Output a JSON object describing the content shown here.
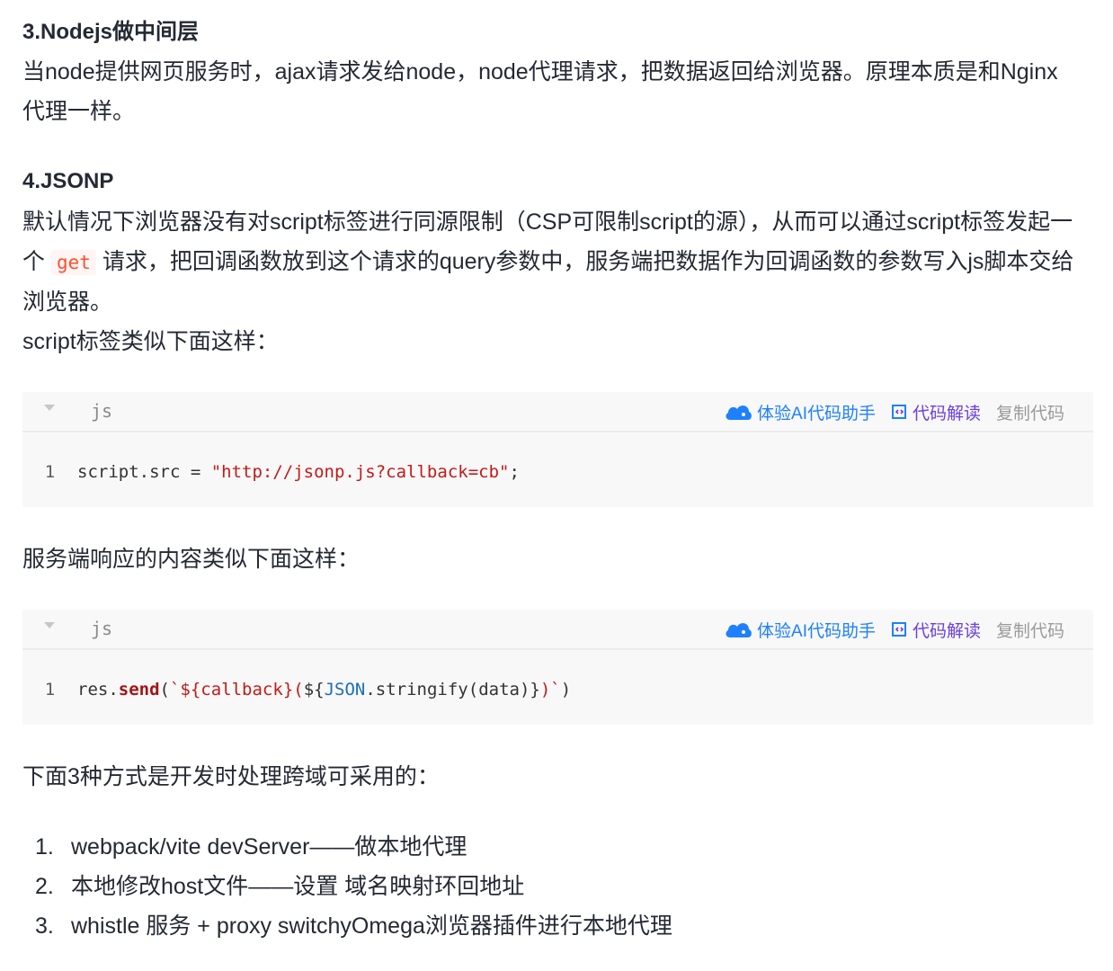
{
  "sections": {
    "nodejs": {
      "title": "3.Nodejs做中间层",
      "body_line1": "当node提供网页服务时，ajax请求发给node，node代理请求，把数据返回给浏览器。原理本质是和Nginx",
      "body_line2": "代理一样。"
    },
    "jsonp": {
      "title": "4.JSONP",
      "line1": "默认情况下浏览器没有对script标签进行同源限制（CSP可限制script的源），从而可以通过script标签发起一",
      "line2_pre": "个 ",
      "line2_code": "get",
      "line2_post": " 请求，把回调函数放到这个请求的query参数中，服务端把数据作为回调函数的参数写入js脚本交给",
      "line3": "浏览器。",
      "script_intro": "script标签类似下面这样："
    },
    "server_intro": "服务端响应的内容类似下面这样：",
    "methods_intro": "下面3种方式是开发时处理跨域可采用的："
  },
  "code_toolbar": {
    "ai_label": "体验AI代码助手",
    "read_label": "代码解读",
    "copy_label": "复制代码"
  },
  "code_blocks": [
    {
      "lang": "js",
      "line_number": "1",
      "tokens": {
        "a": "script.src = ",
        "b": "\"http://jsonp.js?callback=cb\"",
        "c": ";"
      }
    },
    {
      "lang": "js",
      "line_number": "1",
      "tokens": {
        "a": "res.",
        "b": "send",
        "c": "(",
        "d": "`${callback}(",
        "e": "${",
        "f": "JSON",
        "g": ".stringify(data)}",
        "h": ")`",
        "i": ")"
      }
    }
  ],
  "list": [
    {
      "num": "1.",
      "text": "webpack/vite devServer——做本地代理"
    },
    {
      "num": "2.",
      "text": "本地修改host文件——设置 域名映射环回地址"
    },
    {
      "num": "3.",
      "text": "whistle 服务 + proxy switchyOmega浏览器插件进行本地代理"
    }
  ],
  "colors": {
    "accent_blue": "#1e80ff",
    "accent_purple": "#6b3fe0",
    "inline_code": "#ff502c",
    "string": "#c41a16"
  }
}
